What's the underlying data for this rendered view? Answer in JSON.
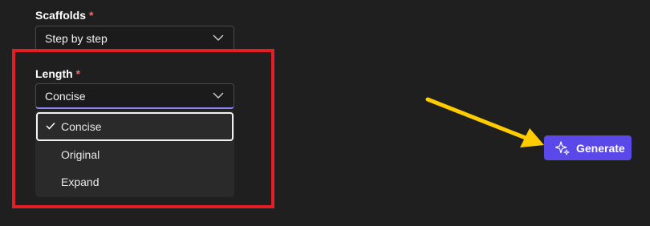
{
  "scaffolds": {
    "label": "Scaffolds",
    "required_mark": "*",
    "value": "Step by step"
  },
  "length": {
    "label": "Length",
    "required_mark": "*",
    "value": "Concise",
    "options": [
      "Concise",
      "Original",
      "Expand"
    ],
    "selected_index": 0
  },
  "generate_button": {
    "label": "Generate",
    "icon": "sparkle-icon"
  },
  "colors": {
    "background": "#1f1f1f",
    "accent": "#5b48e8",
    "highlight_box": "#e31e26",
    "annotation_arrow": "#ffcc00"
  }
}
